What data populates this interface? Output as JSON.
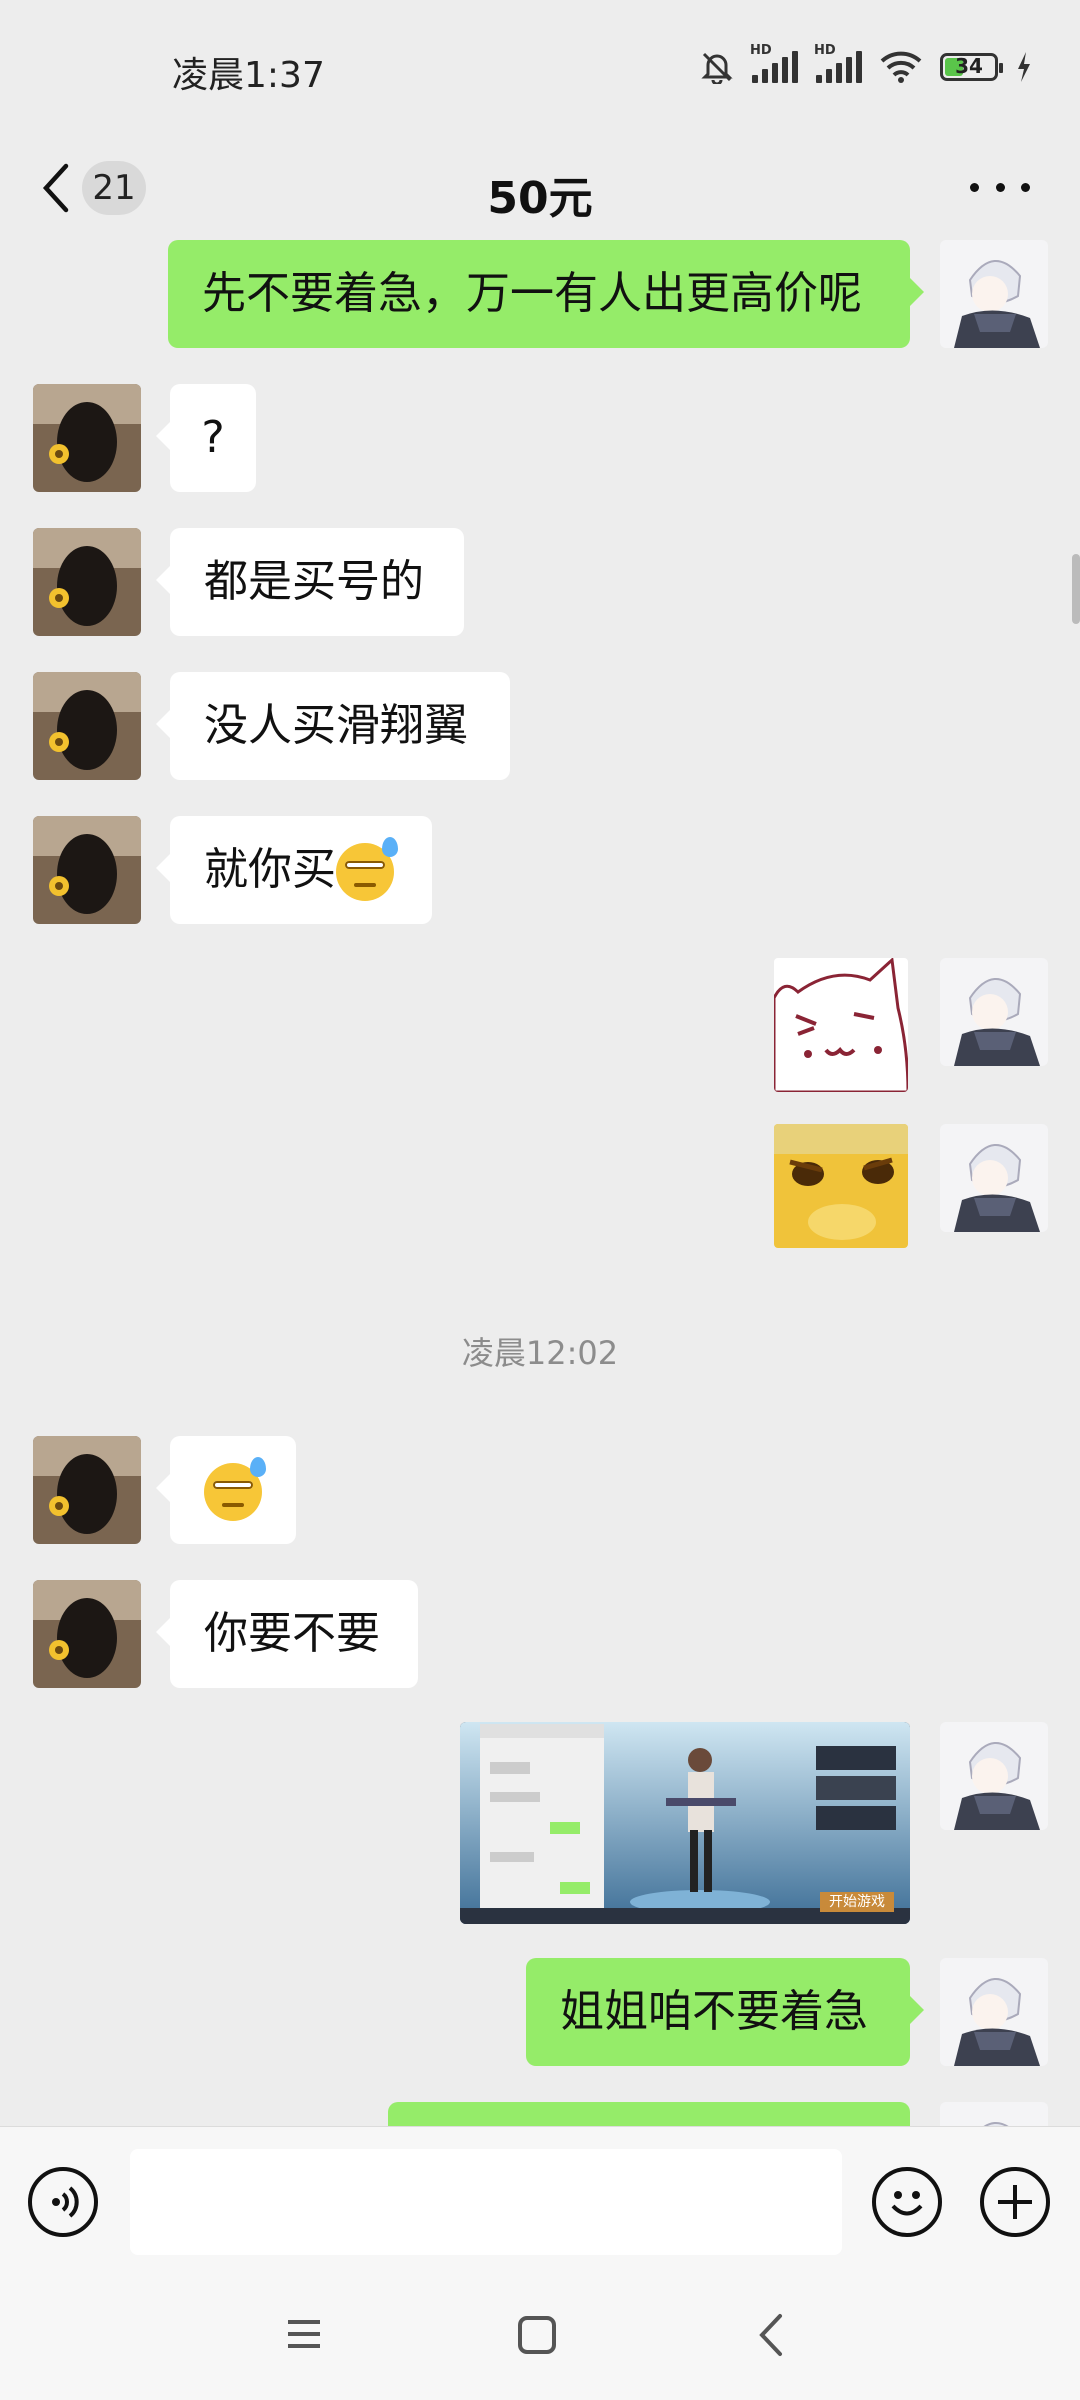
{
  "status_bar": {
    "time": "凌晨1:37",
    "battery": "34",
    "network_1": "HD",
    "network_2": "HD"
  },
  "header": {
    "unread_count": "21",
    "title": "50元"
  },
  "messages": [
    {
      "side": "out",
      "type": "text",
      "text": "先不要着急，万一有人出更高价呢"
    },
    {
      "side": "in",
      "type": "text",
      "text": "?"
    },
    {
      "side": "in",
      "type": "text",
      "text": "都是买号的"
    },
    {
      "side": "in",
      "type": "text",
      "text": "没人买滑翔翼"
    },
    {
      "side": "in",
      "type": "text",
      "text": "就你买"
    },
    {
      "side": "out",
      "type": "sticker",
      "icon": "cat-face-sticker"
    },
    {
      "side": "out",
      "type": "sticker",
      "icon": "yellow-cat-sticker"
    },
    {
      "type": "timestamp",
      "text": "凌晨12:02"
    },
    {
      "side": "in",
      "type": "emoji",
      "icon": "sweat-emoji"
    },
    {
      "side": "in",
      "type": "text",
      "text": "你要不要"
    },
    {
      "side": "out",
      "type": "image",
      "icon": "game-screenshot-image",
      "overlay_text": "开始游戏"
    },
    {
      "side": "out",
      "type": "text",
      "text": "姐姐咱不要着急"
    }
  ],
  "icons": {
    "back": "chevron-left-icon",
    "more": "more-icon",
    "voice": "voice-icon",
    "emoji": "emoji-icon",
    "add": "add-icon",
    "nav_menu": "menu-icon",
    "nav_home": "home-icon",
    "nav_back": "back-icon"
  },
  "colors": {
    "outgoing_bubble": "#95ec69",
    "incoming_bubble": "#ffffff",
    "background": "#ededed"
  }
}
